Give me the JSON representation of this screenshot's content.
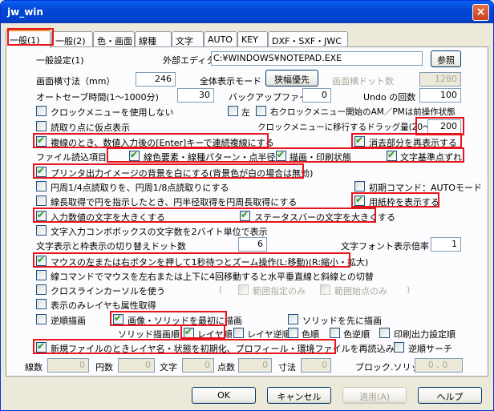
{
  "window": {
    "title": "jw_win",
    "close": "×"
  },
  "tabs": [
    "一般(1)",
    "一般(2)",
    "色・画面",
    "線種",
    "文字",
    "AUTO",
    "KEY",
    "DXF・SXF・JWC"
  ],
  "section_title": "一般設定(1)",
  "editor": {
    "label": "外部エディタ",
    "value": "C:¥WINDOWS¥NOTEPAD.EXE",
    "browse": "参照"
  },
  "screen_width": {
    "label": "画面横寸法（mm）",
    "value": "246"
  },
  "display_mode": {
    "label": "全体表示モード",
    "button": "狭幅優先"
  },
  "screen_dots": {
    "label": "画面横ドット数",
    "value": "1280"
  },
  "autosave": {
    "label": "オートセーブ時間(1〜1000分)",
    "value": "30"
  },
  "backup": {
    "label": "バックアップファイル数",
    "value": "0"
  },
  "undo": {
    "label": "Undo の回数",
    "value": "100"
  },
  "clock_menu": "クロックメニューを使用しない",
  "left": "左",
  "right_clock": "右クロックメニュー開始のAM／PMは前操作状態",
  "read_point": "読取り点に仮点表示",
  "drag_amount": {
    "label": "クロックメニューに移行するドラッグ量(20〜200)",
    "value": "200"
  },
  "multi_line": "複線のとき、数値入力後の[Enter]キーで連続複線にする",
  "hidden_redraw": "消去部分を再表示する",
  "file_read": {
    "label": "ファイル読込項目",
    "color": "線色要素・線種パターン・点半径",
    "draw": "描画・印刷状態",
    "text": "文字基準点ずれ"
  },
  "printer_bg": "プリンタ出力イメージの背景を白にする(背景色が白の場合は無効)",
  "circle_read": "円周1/4点読取りを、円周1/8点読取りにする",
  "initial_cmd": "初期コマンド：AUTOモード",
  "line_length": "線長取得で円を指示したとき、円半径取得を円周長取得にする",
  "paper_frame": "用紙枠を表示する",
  "input_large": "入力数値の文字を大きくする",
  "status_large": "ステータスバーの文字を大きくする",
  "combobox": "文字入力コンボボックスの文字数を2バイト単位で表示",
  "text_switch": {
    "label": "文字表示と枠表示の切り替えドット数",
    "value": "6"
  },
  "text_zoom": {
    "label": "文字フォント表示倍率",
    "value": "1"
  },
  "mouse_zoom": "マウスの左または右ボタンを押して1秒待つとズーム操作(L:移動)(R:縮小・拡大)",
  "mouse_lr": "線コマンドでマウスを左右または上下に4回移動すると水平垂直線と斜線との切替",
  "crossline": "クロスラインカーソルを使う",
  "range_only": "範囲指定のみ",
  "range_point": "範囲始点のみ",
  "layer_attr": "表示のみレイヤも属性取得",
  "reverse_draw": "逆順描画",
  "image_solid": "画像・ソリッドを最初に描画",
  "solid_first": "ソリッドを先に描画",
  "solid_order": {
    "label": "ソリッド描画順",
    "layer": "レイヤ順",
    "layer_rev": "レイヤ逆順",
    "color": "色順",
    "color_rev": "色逆順",
    "print": "印刷出力設定順"
  },
  "new_file": "新規ファイルのときレイヤ名・状態を初期化、プロフィール・環境ファイルを再読込み",
  "reverse_search": "逆順サーチ",
  "status_fields": {
    "lines": "線数",
    "lines_v": "0",
    "circles": "円数",
    "circles_v": "0",
    "texts": "文字",
    "texts_v": "0",
    "points": "点数",
    "points_v": "0",
    "dims": "寸法",
    "dims_v": "0",
    "block": "ブロック.ソリッド",
    "block_v": "0 , 0"
  },
  "buttons": {
    "ok": "OK",
    "cancel": "キャンセル",
    "apply": "適用(A)",
    "help": "ヘルプ"
  }
}
